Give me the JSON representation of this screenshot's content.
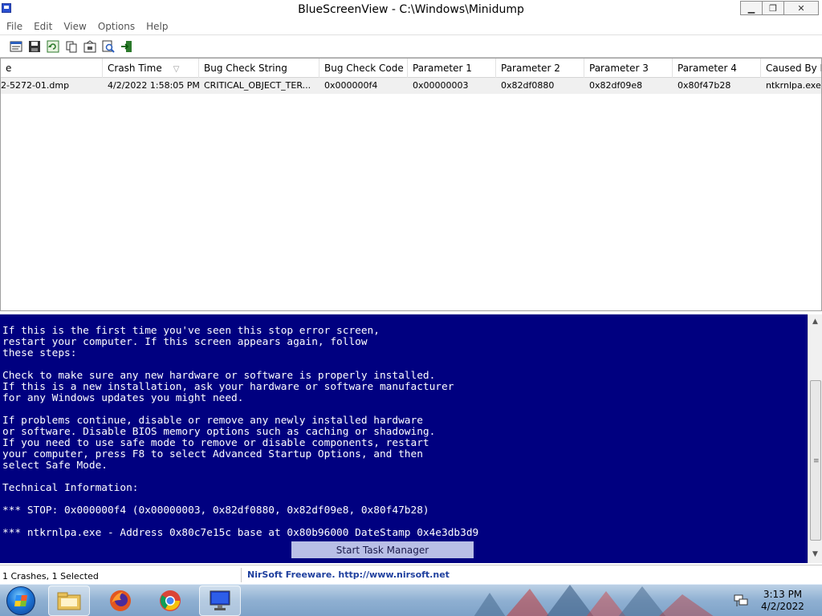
{
  "window": {
    "title": "BlueScreenView  -  C:\\Windows\\Minidump",
    "minimize_glyph": "▁",
    "maximize_glyph": "❐",
    "close_glyph": "✕"
  },
  "menu": [
    "File",
    "Edit",
    "View",
    "Options",
    "Help"
  ],
  "toolbar": {
    "icons": [
      "properties-icon",
      "save-icon",
      "refresh-icon",
      "copy-icon",
      "options-icon",
      "find-icon",
      "exit-icon"
    ]
  },
  "columns": [
    {
      "label": "e"
    },
    {
      "label": "Crash Time",
      "sort": "▽"
    },
    {
      "label": "Bug Check String"
    },
    {
      "label": "Bug Check Code"
    },
    {
      "label": "Parameter 1"
    },
    {
      "label": "Parameter 2"
    },
    {
      "label": "Parameter 3"
    },
    {
      "label": "Parameter 4"
    },
    {
      "label": "Caused By Dri"
    }
  ],
  "rows": [
    [
      "2-5272-01.dmp",
      "4/2/2022 1:58:05 PM",
      "CRITICAL_OBJECT_TER...",
      "0x000000f4",
      "0x00000003",
      "0x82df0880",
      "0x82df09e8",
      "0x80f47b28",
      "ntkrnlpa.exe"
    ]
  ],
  "hscroll": {
    "left": "◀",
    "right": "▶",
    "grip": "|||"
  },
  "bsod": {
    "text": "If this is the first time you've seen this stop error screen,\nrestart your computer. If this screen appears again, follow\nthese steps:\n\nCheck to make sure any new hardware or software is properly installed.\nIf this is a new installation, ask your hardware or software manufacturer\nfor any Windows updates you might need.\n\nIf problems continue, disable or remove any newly installed hardware\nor software. Disable BIOS memory options such as caching or shadowing.\nIf you need to use safe mode to remove or disable components, restart\nyour computer, press F8 to select Advanced Startup Options, and then\nselect Safe Mode.\n\nTechnical Information:\n\n*** STOP: 0x000000f4 (0x00000003, 0x82df0880, 0x82df09e8, 0x80f47b28)\n\n*** ntkrnlpa.exe - Address 0x80c7e15c base at 0x80b96000 DateStamp 0x4e3db3d9",
    "background": "#000080",
    "text_color": "#ffffff"
  },
  "vscroll": {
    "up": "▲",
    "down": "▼",
    "grip": "≡"
  },
  "context_item": "Start Task Manager",
  "status": {
    "count": "1 Crashes, 1 Selected",
    "link": "NirSoft Freeware.  http://www.nirsoft.net"
  },
  "taskbar": {
    "apps": [
      "explorer-icon",
      "firefox-icon",
      "chrome-icon",
      "bluescreenview-icon"
    ],
    "time": "3:13 PM",
    "date": "4/2/2022"
  }
}
